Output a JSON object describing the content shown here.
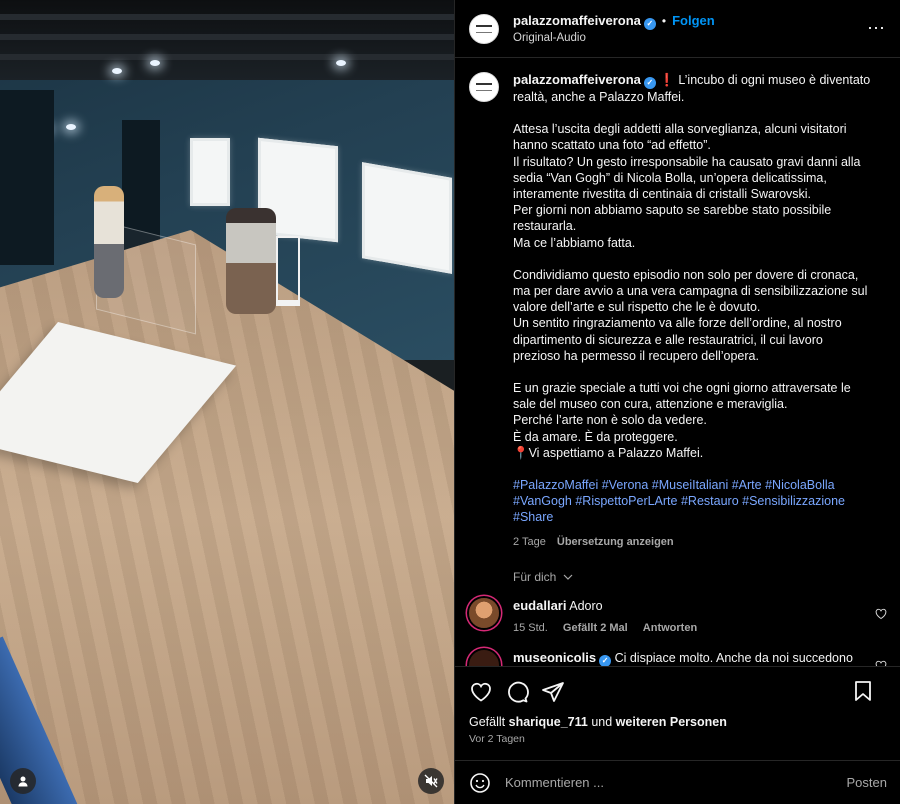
{
  "header": {
    "username": "palazzomaffeiverona",
    "dot": "•",
    "follow_label": "Folgen",
    "audio_label": "Original-Audio",
    "more_label": "⋯"
  },
  "caption": {
    "username": "palazzomaffeiverona",
    "p1": "❗ L’incubo di ogni museo è diventato realtà, anche a Palazzo Maffei.",
    "p2a": "Attesa l’uscita degli addetti alla sorveglianza, alcuni visitatori hanno scattato una foto “ad effetto”.",
    "p2b": "Il risultato? Un gesto irresponsabile ha causato gravi danni alla sedia “Van Gogh” di Nicola Bolla, un’opera delicatissima, interamente rivestita di centinaia di cristalli Swarovski.",
    "p2c": "Per giorni non abbiamo saputo se sarebbe stato possibile restaurarla.",
    "p2d": "Ma ce l’abbiamo fatta.",
    "p3a": "Condividiamo questo episodio non solo per dovere di cronaca, ma per dare avvio a una vera campagna di sensibilizzazione sul valore dell’arte e sul rispetto che le è dovuto.",
    "p3b": "Un sentito ringraziamento va alle forze dell’ordine, al nostro dipartimento di sicurezza e alle restauratrici, il cui lavoro prezioso ha permesso il recupero dell’opera.",
    "p4a": "E un grazie speciale a tutti voi che ogni giorno attraversate le sale del museo con cura, attenzione e meraviglia.",
    "p4b": "Perché l’arte non è solo da vedere.",
    "p4c": "È da amare. È da proteggere.",
    "p4d": "📍Vi aspettiamo a Palazzo Maffei.",
    "hashtags": [
      "#PalazzoMaffei",
      "#Verona",
      "#MuseiItaliani",
      "#Arte",
      "#NicolaBolla",
      "#VanGogh",
      "#RispettoPerLArte",
      "#Restauro",
      "#Sensibilizzazione",
      "#Share"
    ],
    "age": "2 Tage",
    "translate_label": "Übersetzung anzeigen"
  },
  "fordich_label": "Für dich",
  "comments": [
    {
      "username": "eudallari",
      "text": "Adoro",
      "age": "15 Std.",
      "likes": "Gefällt 2 Mal",
      "reply_label": "Antworten",
      "avatar_color": "#c27a4a"
    },
    {
      "username": "museonicolis",
      "text": "Ci dispiace molto. Anche da noi succedono",
      "avatar_color": "#3a1c12"
    }
  ],
  "likes": {
    "prefix": "Gefällt",
    "user": "sharique_711",
    "middle": "und",
    "others": "weiteren Personen"
  },
  "post_date": "Vor 2 Tagen",
  "composer": {
    "placeholder": "Kommentieren ...",
    "post_label": "Posten"
  },
  "colors": {
    "accent": "#0095f6",
    "verified": "#3897f0",
    "hashtag": "#7aa7ff",
    "background": "#000000"
  }
}
